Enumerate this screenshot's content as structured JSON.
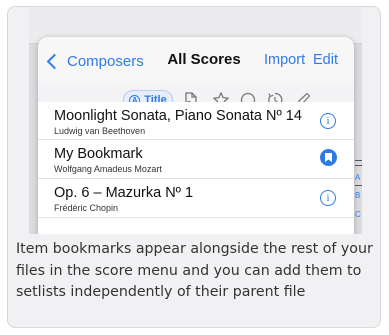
{
  "nav": {
    "back_label": "Composers",
    "title": "All Scores",
    "import_label": "Import",
    "edit_label": "Edit"
  },
  "filters": {
    "active_label": "Title",
    "active_badge": "A",
    "icons": [
      "page-icon",
      "star-icon",
      "circle-icon",
      "history-icon",
      "edit-icon"
    ]
  },
  "scores": [
    {
      "title": "Moonlight Sonata, Piano Sonata Nº 14",
      "composer": "Ludwig van Beethoven",
      "action": "info-icon"
    },
    {
      "title": "My Bookmark",
      "composer": "Wolfgang Amadeus Mozart",
      "action": "bookmark-icon"
    },
    {
      "title": "Op. 6 – Mazurka Nº 1",
      "composer": "Frédéric Chopin",
      "action": "info-icon"
    }
  ],
  "index_letters": [
    "A",
    "B",
    "C"
  ],
  "caption": "Item bookmarks appear alongside the rest of your files in the score menu and you can add them to setlists independently of their parent file",
  "colors": {
    "accent": "#2f7ae5",
    "card_bg": "#f1f1f3"
  }
}
